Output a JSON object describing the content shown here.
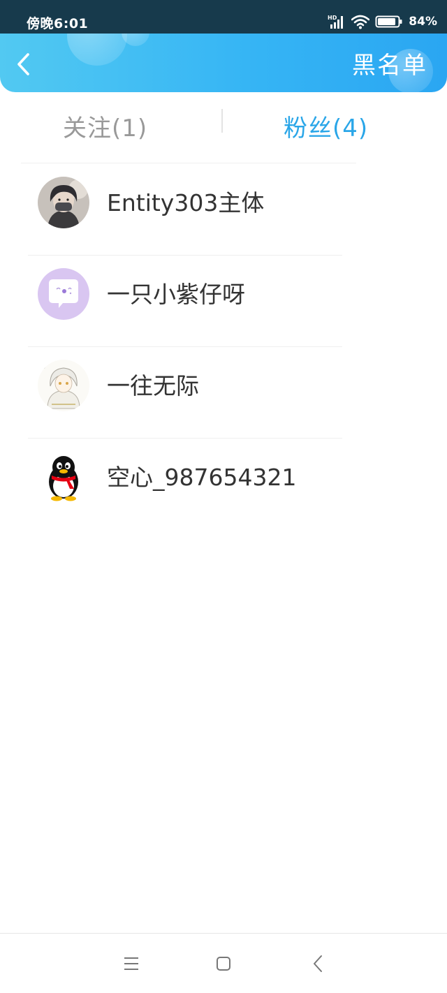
{
  "status_bar": {
    "time": "傍晚6:01",
    "network_label": "HD",
    "battery": "84%"
  },
  "header": {
    "title": "黑名单",
    "back_icon": "chevron-left-icon"
  },
  "tabs": [
    {
      "label": "关注(1)",
      "active": false
    },
    {
      "label": "粉丝(4)",
      "active": true
    }
  ],
  "users": [
    {
      "name": "Entity303主体",
      "avatar": "dark-anime-avatar"
    },
    {
      "name": "一只小紫仔呀",
      "avatar": "purple-chat-bubble-avatar"
    },
    {
      "name": "一往无际",
      "avatar": "sketch-anime-avatar"
    },
    {
      "name": "空心_987654321",
      "avatar": "qq-penguin-avatar"
    }
  ],
  "nav_bar": {
    "menu_icon": "menu-icon",
    "home_icon": "home-square-icon",
    "back_icon": "back-triangle-icon"
  },
  "colors": {
    "status_bar_bg": "#173a4c",
    "header_start": "#52c9f2",
    "header_end": "#2aa6f2",
    "tab_active": "#2aa6e8",
    "tab_inactive": "#999999",
    "text_primary": "#333333"
  }
}
